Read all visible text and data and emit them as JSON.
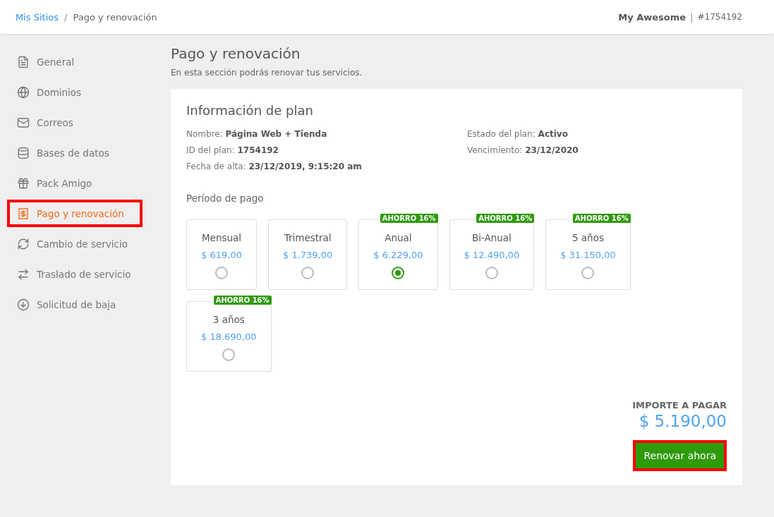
{
  "breadcrumb": [
    {
      "label": "Mis Sitios",
      "link": true
    },
    {
      "label": "Pago y renovación",
      "link": false
    }
  ],
  "breadcrumb_separator": "/",
  "account": {
    "name": "My Awesome",
    "separator": "|",
    "id": "#1754192"
  },
  "sidebar": {
    "items": [
      {
        "label": "General",
        "selected": false
      },
      {
        "label": "Dominios",
        "selected": false
      },
      {
        "label": "Correos",
        "selected": false
      },
      {
        "label": "Bases de datos",
        "selected": false
      },
      {
        "label": "Pack Amigo",
        "selected": false
      },
      {
        "label": "Pago y renovación",
        "selected": true
      },
      {
        "label": "Cambio de servicio",
        "selected": false
      },
      {
        "label": "Traslado de servicio",
        "selected": false
      },
      {
        "label": "Solicitud de baja",
        "selected": false
      }
    ]
  },
  "page": {
    "title": "Pago y renovación",
    "subtitle": "En esta sección podrás renovar tus servicios."
  },
  "plan_info": {
    "title": "Información de plan",
    "left": [
      "Nombre: **Página Web + Tienda**",
      "ID del plan: **1754192**",
      "Fecha de alta: **23/12/2019, 9:15:20 am**"
    ],
    "right": [
      "Estado del plan: **Activo**",
      "Vencimiento: **23/12/2020**"
    ]
  },
  "payment_period": {
    "title": "Período de pago",
    "options": [
      {
        "name": "Mensual",
        "price": "$ 619,00",
        "selected": false
      },
      {
        "name": "Trimestral",
        "price": "$ 1.739,00",
        "selected": false
      },
      {
        "name": "Anual",
        "price": "$ 6.229,00",
        "badge": "AHORRO 16%",
        "selected": true
      },
      {
        "name": "Bi-Anual",
        "price": "$ 12.490,00",
        "badge": "AHORRO 16%",
        "selected": false
      },
      {
        "name": "5 años",
        "price": "$ 31.150,00",
        "badge": "AHORRO 16%",
        "selected": false
      },
      {
        "name": "3 años",
        "price": "$ 18.690,00",
        "badge": "AHORRO 16%",
        "selected": false
      }
    ]
  },
  "total": {
    "label": "IMPORTE A PAGAR",
    "amount": "$ 5.190,00"
  },
  "renew_button": "Renovar ahora"
}
